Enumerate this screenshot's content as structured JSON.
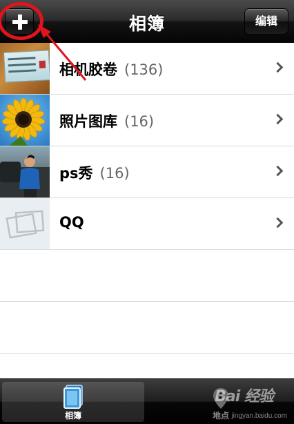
{
  "navbar": {
    "title": "相簿",
    "add_label": "+",
    "edit_label": "编辑"
  },
  "albums": [
    {
      "name": "相机胶卷",
      "count": "(136)",
      "thumb": "ticket-photo"
    },
    {
      "name": "照片图库",
      "count": "(16)",
      "thumb": "sunflower-photo"
    },
    {
      "name": "ps秀",
      "count": "(16)",
      "thumb": "person-photo"
    },
    {
      "name": "QQ",
      "count": "",
      "thumb": "placeholder-photos"
    }
  ],
  "tabbar": {
    "tabs": [
      {
        "label": "相簿",
        "icon": "album-icon",
        "active": true
      },
      {
        "label": "地点",
        "icon": "location-pin-icon",
        "active": false
      }
    ]
  },
  "watermark": {
    "text": "Bai 经验",
    "url": "jingyan.baidu.com"
  },
  "colors": {
    "annotation_red": "#e0141b",
    "navbar": "#1a1a1a"
  }
}
